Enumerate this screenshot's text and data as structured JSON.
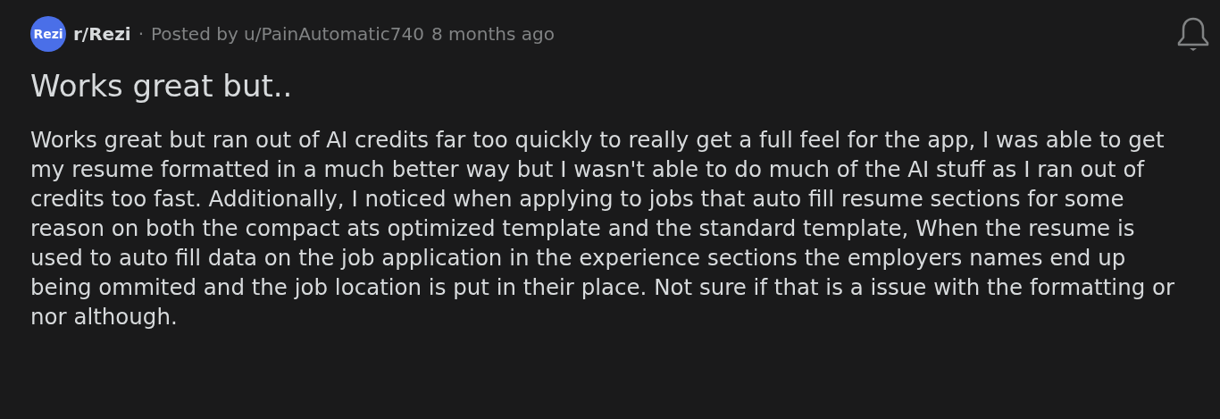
{
  "post": {
    "community_badge": "Rezi",
    "community": "r/Rezi",
    "separator": "·",
    "byline": "Posted by u/PainAutomatic740",
    "time": "8 months ago",
    "title": "Works great but..",
    "body": "Works great but ran out of AI credits far too quickly to really get a full feel for the app, I was able to get my resume formatted in a much better way but I wasn't able to do much of the AI stuff as I ran out of credits too fast. Additionally, I noticed when applying to jobs that auto fill resume sections for some reason on both the compact ats optimized template and the standard template, When the resume is used to auto fill data on the job application in the experience sections the employers names end up being ommited and the job location is put in their place. Not sure if that is a issue with the formatting or nor although."
  }
}
